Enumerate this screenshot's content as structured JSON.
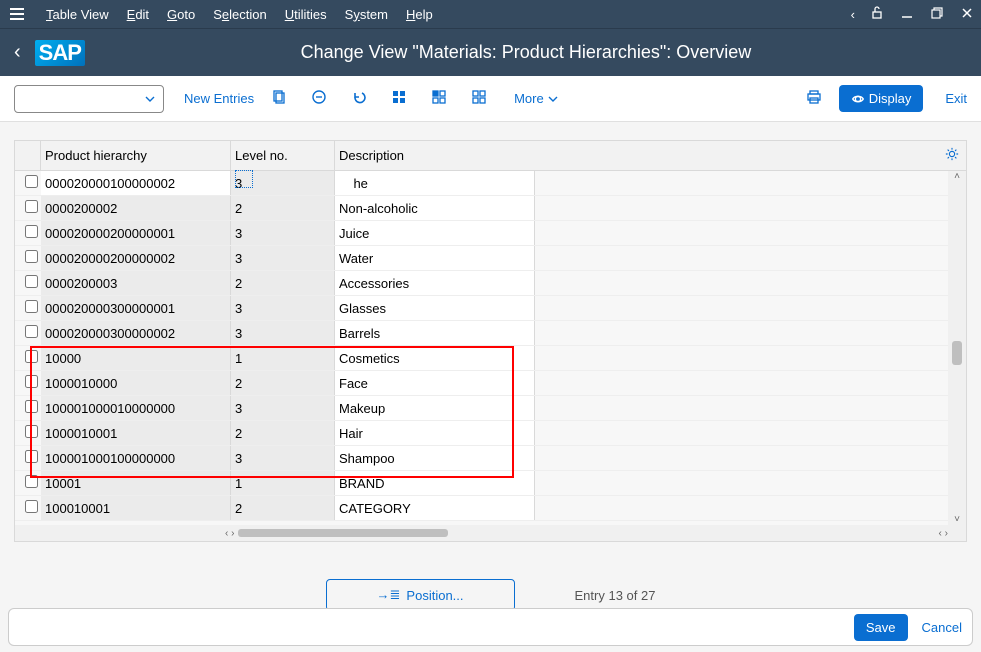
{
  "menu": {
    "items": [
      "Table View",
      "Edit",
      "Goto",
      "Selection",
      "Utilities",
      "System",
      "Help"
    ]
  },
  "title": "Change View \"Materials: Product Hierarchies\": Overview",
  "toolbar": {
    "new_entries": "New Entries",
    "more": "More",
    "display": "Display",
    "exit": "Exit"
  },
  "columns": {
    "ph": "Product hierarchy",
    "lvl": "Level no.",
    "desc": "Description"
  },
  "rows": [
    {
      "ph": "000020000100000002",
      "lvl": "3",
      "desc": "he",
      "first": true
    },
    {
      "ph": "0000200002",
      "lvl": "2",
      "desc": "Non-alcoholic"
    },
    {
      "ph": "000020000200000001",
      "lvl": "3",
      "desc": "Juice"
    },
    {
      "ph": "000020000200000002",
      "lvl": "3",
      "desc": "Water"
    },
    {
      "ph": "0000200003",
      "lvl": "2",
      "desc": "Accessories"
    },
    {
      "ph": "000020000300000001",
      "lvl": "3",
      "desc": "Glasses"
    },
    {
      "ph": "000020000300000002",
      "lvl": "3",
      "desc": "Barrels"
    },
    {
      "ph": "10000",
      "lvl": "1",
      "desc": "Cosmetics"
    },
    {
      "ph": "1000010000",
      "lvl": "2",
      "desc": "Face"
    },
    {
      "ph": "100001000010000000",
      "lvl": "3",
      "desc": "Makeup"
    },
    {
      "ph": "1000010001",
      "lvl": "2",
      "desc": "Hair"
    },
    {
      "ph": "100001000100000000",
      "lvl": "3",
      "desc": "Shampoo"
    },
    {
      "ph": "10001",
      "lvl": "1",
      "desc": "BRAND"
    },
    {
      "ph": "100010001",
      "lvl": "2",
      "desc": "CATEGORY"
    }
  ],
  "position_btn": "Position...",
  "entry_text": "Entry 13 of 27",
  "save": "Save",
  "cancel": "Cancel"
}
